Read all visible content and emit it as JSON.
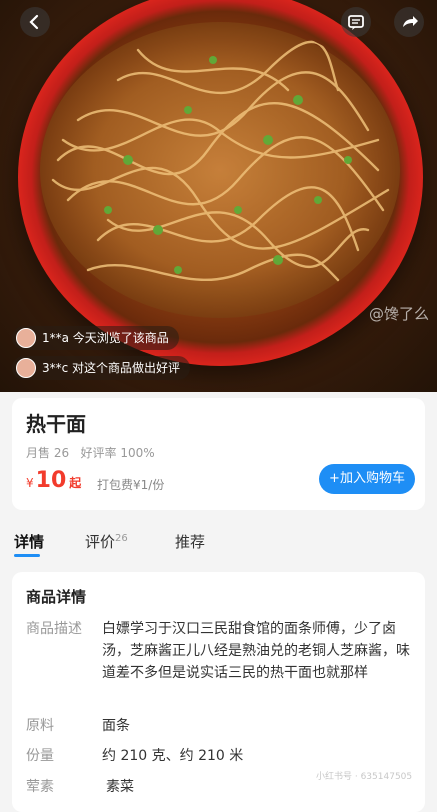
{
  "header": {
    "back_icon": "back-arrow-icon",
    "message_icon": "message-icon",
    "share_icon": "share-icon"
  },
  "hero": {
    "image_watermark": "@馋了么",
    "activity": [
      {
        "text": "1**a 今天浏览了该商品"
      },
      {
        "text": "3**c 对这个商品做出好评"
      }
    ]
  },
  "product": {
    "name": "热干面",
    "monthly_sales": "月售 26",
    "positive_rate": "好评率 100%",
    "currency": "¥",
    "price": "10",
    "price_unit": "起",
    "delivery": "打包费¥1/份",
    "add_to_cart": "+加入购物车"
  },
  "tabs": [
    {
      "label": "详情",
      "active": true
    },
    {
      "label": "评价",
      "count": "26"
    },
    {
      "label": "推荐"
    }
  ],
  "details": {
    "section_title": "商品详情",
    "rows": [
      {
        "key": "商品描述",
        "value": "白嫖学习于汉口三民甜食馆的面条师傅，少了卤汤，芝麻酱正儿八经是熟油兑的老铜人芝麻酱，味道差不多但是说实话三民的热干面也就那样"
      },
      {
        "key": "原料",
        "value": "面条"
      },
      {
        "key": "份量",
        "value": "约 210 克、约 210 米"
      },
      {
        "key": "荤素",
        "value": "素菜"
      }
    ]
  },
  "page_watermark": "小红书号 · 635147505",
  "colors": {
    "accent": "#1e8ef5",
    "price": "#f23b2c"
  }
}
